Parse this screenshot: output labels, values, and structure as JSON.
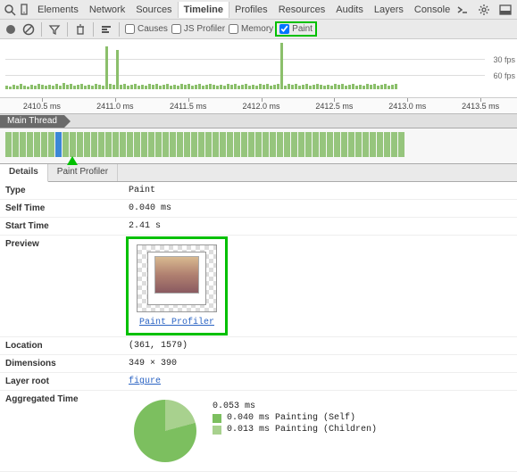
{
  "topbar": {
    "tabs": [
      "Elements",
      "Network",
      "Sources",
      "Timeline",
      "Profiles",
      "Resources",
      "Audits",
      "Layers",
      "Console"
    ],
    "active": 3
  },
  "toolbar": {
    "checkboxes": {
      "causes": "Causes",
      "jsprofiler": "JS Profiler",
      "memory": "Memory",
      "paint": "Paint"
    }
  },
  "fps": {
    "l30": "30 fps",
    "l60": "60 fps"
  },
  "ruler": [
    "2410.5 ms",
    "2411.0 ms",
    "2411.5 ms",
    "2412.0 ms",
    "2412.5 ms",
    "2413.0 ms",
    "2413.5 ms"
  ],
  "breadcrumb": "Main Thread",
  "subtabs": {
    "details": "Details",
    "profiler": "Paint Profiler",
    "active": 0
  },
  "details": {
    "type_label": "Type",
    "type": "Paint",
    "self_label": "Self Time",
    "self": "0.040 ms",
    "start_label": "Start Time",
    "start": "2.41 s",
    "preview_label": "Preview",
    "preview_link": "Paint Profiler",
    "location_label": "Location",
    "location": "(361, 1579)",
    "dim_label": "Dimensions",
    "dim": "349 × 390",
    "layer_label": "Layer root",
    "layer": "figure",
    "agg_label": "Aggregated Time",
    "agg_total": "0.053 ms",
    "agg_self": "0.040 ms Painting (Self)",
    "agg_children": "0.013 ms Painting (Children)"
  }
}
